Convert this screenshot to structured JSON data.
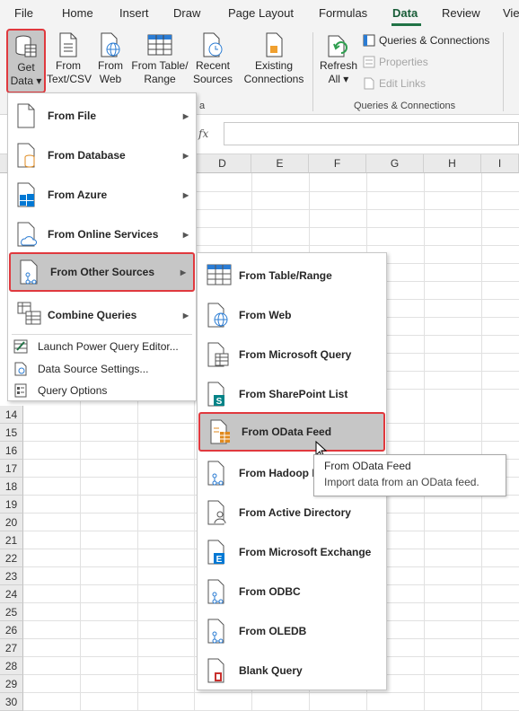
{
  "ribbon_tabs": [
    "File",
    "Home",
    "Insert",
    "Draw",
    "Page Layout",
    "Formulas",
    "Data",
    "Review",
    "Vie"
  ],
  "active_tab": "Data",
  "ribbon": {
    "get_data": [
      "Get",
      "Data ▾"
    ],
    "from_text_csv": [
      "From",
      "Text/CSV"
    ],
    "from_web": [
      "From",
      "Web"
    ],
    "from_table_range": [
      "From Table/",
      "Range"
    ],
    "recent_sources": [
      "Recent",
      "Sources"
    ],
    "existing_connections": [
      "Existing",
      "Connections"
    ],
    "refresh_all": [
      "Refresh",
      "All ▾"
    ],
    "queries_connections": "Queries & Connections",
    "properties": "Properties",
    "edit_links": "Edit Links",
    "group_get_transform_partial": "a",
    "group_queries": "Queries & Connections"
  },
  "formula_bar": {
    "fx": "fx",
    "value": ""
  },
  "columns": [
    "D",
    "E",
    "F",
    "G",
    "H",
    "I"
  ],
  "rows": [
    "14",
    "15",
    "16",
    "17",
    "18",
    "19",
    "20",
    "21",
    "22",
    "23",
    "24",
    "25",
    "26",
    "27",
    "28",
    "29",
    "30"
  ],
  "get_data_menu": {
    "items": [
      {
        "label": "From File",
        "submenu": true
      },
      {
        "label": "From Database",
        "submenu": true
      },
      {
        "label": "From Azure",
        "submenu": true
      },
      {
        "label": "From Online Services",
        "submenu": true
      },
      {
        "label": "From Other Sources",
        "submenu": true,
        "selected": true
      },
      {
        "label": "Combine Queries",
        "submenu": true
      }
    ],
    "small_items": [
      "Launch Power Query Editor...",
      "Data Source Settings...",
      "Query Options"
    ]
  },
  "other_sources_menu": {
    "items": [
      {
        "label": "From Table/Range"
      },
      {
        "label": "From Web"
      },
      {
        "label": "From Microsoft Query"
      },
      {
        "label": "From SharePoint List"
      },
      {
        "label": "From OData Feed",
        "selected": true
      },
      {
        "label": "From Hadoop F"
      },
      {
        "label": "From Active Directory"
      },
      {
        "label": "From Microsoft Exchange"
      },
      {
        "label": "From ODBC"
      },
      {
        "label": "From OLEDB"
      },
      {
        "label": "Blank Query"
      }
    ]
  },
  "tooltip": {
    "title": "From OData Feed",
    "body": "Import data from an OData feed."
  },
  "colors": {
    "accent": "#217346",
    "highlight": "#e0393e",
    "selection": "#c6c6c6"
  }
}
